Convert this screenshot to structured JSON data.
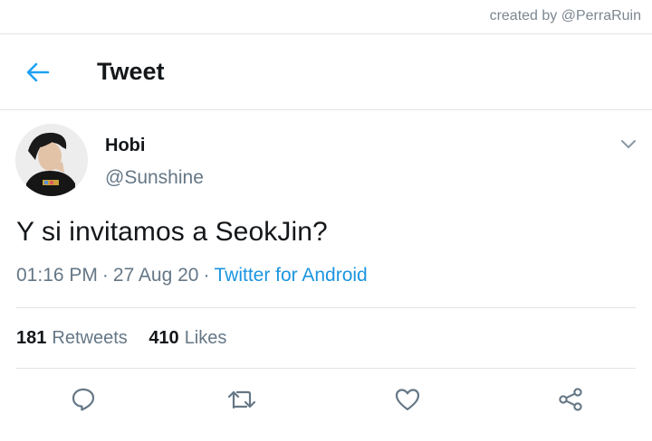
{
  "credit": "created by @PerraRuin",
  "header": {
    "title": "Tweet"
  },
  "user": {
    "display_name": "Hobi",
    "handle": "@Sunshine"
  },
  "tweet": {
    "text": "Y si invitamos a SeokJin?",
    "time": "01:16 PM",
    "date": "27 Aug 20",
    "source": "Twitter for Android",
    "separator": "·"
  },
  "stats": {
    "retweets_count": "181",
    "retweets_label": "Retweets",
    "likes_count": "410",
    "likes_label": "Likes"
  },
  "colors": {
    "accent": "#1da1f2",
    "secondary_text": "#657786",
    "divider": "#e1e4e6"
  },
  "icons": [
    "back-arrow-icon",
    "chevron-down-icon",
    "reply-icon",
    "retweet-icon",
    "like-icon",
    "share-icon"
  ]
}
